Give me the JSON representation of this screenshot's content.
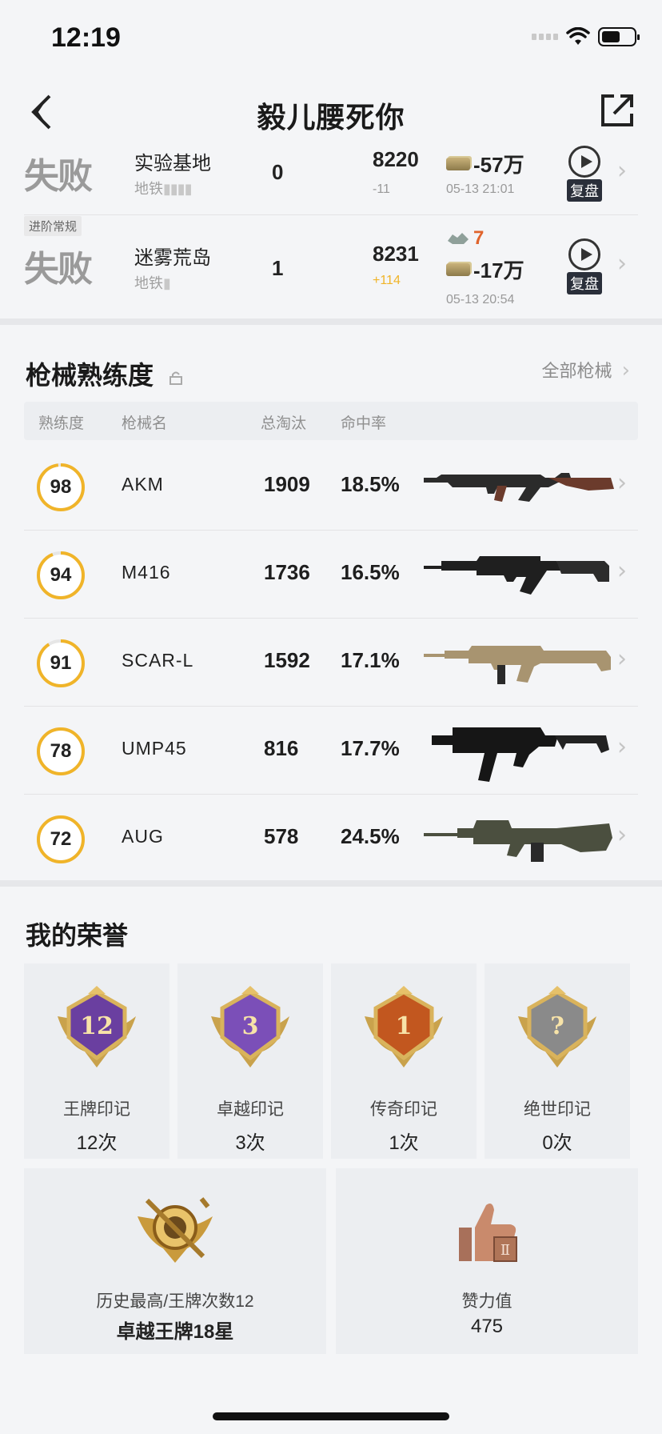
{
  "status_bar": {
    "time": "12:19"
  },
  "header": {
    "title": "毅儿腰死你"
  },
  "matches": [
    {
      "result": "失败",
      "map": "实验基地",
      "mode": "地铁",
      "mode_tag": "",
      "kills": "0",
      "rating": "8220",
      "rating_delta": "-11",
      "loot": [
        {
          "icon": "gold-bars-icon",
          "value": "-57万"
        }
      ],
      "date": "05-13 21:01",
      "replay_label": "复盘"
    },
    {
      "result": "失败",
      "map": "迷雾荒岛",
      "mode": "地铁",
      "mode_tag": "进阶常规",
      "kills": "1",
      "rating": "8231",
      "rating_delta": "+114",
      "loot": [
        {
          "icon": "armor-icon",
          "value": "7"
        },
        {
          "icon": "gold-bars-icon",
          "value": "-17万"
        }
      ],
      "date": "05-13 20:54",
      "replay_label": "复盘"
    }
  ],
  "weapons_section": {
    "title": "枪械熟练度",
    "all_link": "全部枪械",
    "columns": [
      "熟练度",
      "枪械名",
      "总淘汰",
      "命中率"
    ],
    "rows": [
      {
        "proficiency": "98",
        "proficiency_pct": 0.98,
        "name": "AKM",
        "kills": "1909",
        "accuracy": "18.5%"
      },
      {
        "proficiency": "94",
        "proficiency_pct": 0.94,
        "name": "M416",
        "kills": "1736",
        "accuracy": "16.5%"
      },
      {
        "proficiency": "91",
        "proficiency_pct": 0.91,
        "name": "SCAR-L",
        "kills": "1592",
        "accuracy": "17.1%"
      },
      {
        "proficiency": "78",
        "proficiency_pct": 1.0,
        "name": "UMP45",
        "kills": "816",
        "accuracy": "17.7%"
      },
      {
        "proficiency": "72",
        "proficiency_pct": 1.0,
        "name": "AUG",
        "kills": "578",
        "accuracy": "24.5%"
      }
    ]
  },
  "honors_section": {
    "title": "我的荣誉",
    "marks": [
      {
        "name": "王牌印记",
        "count": "12次",
        "badge_text": "12",
        "color": "#6a3fa0"
      },
      {
        "name": "卓越印记",
        "count": "3次",
        "badge_text": "3",
        "color": "#7b4fb8"
      },
      {
        "name": "传奇印记",
        "count": "1次",
        "badge_text": "1",
        "color": "#c2571f"
      },
      {
        "name": "绝世印记",
        "count": "0次",
        "badge_text": "?",
        "color": "#8a8a8a"
      }
    ],
    "highest": {
      "label": "历史最高/王牌次数12",
      "value": "卓越王牌18星"
    },
    "likes": {
      "label": "赞力值",
      "value": "475"
    }
  },
  "colors": {
    "accent_yellow": "#f0b429",
    "ring_track": "#e6e6e6"
  }
}
